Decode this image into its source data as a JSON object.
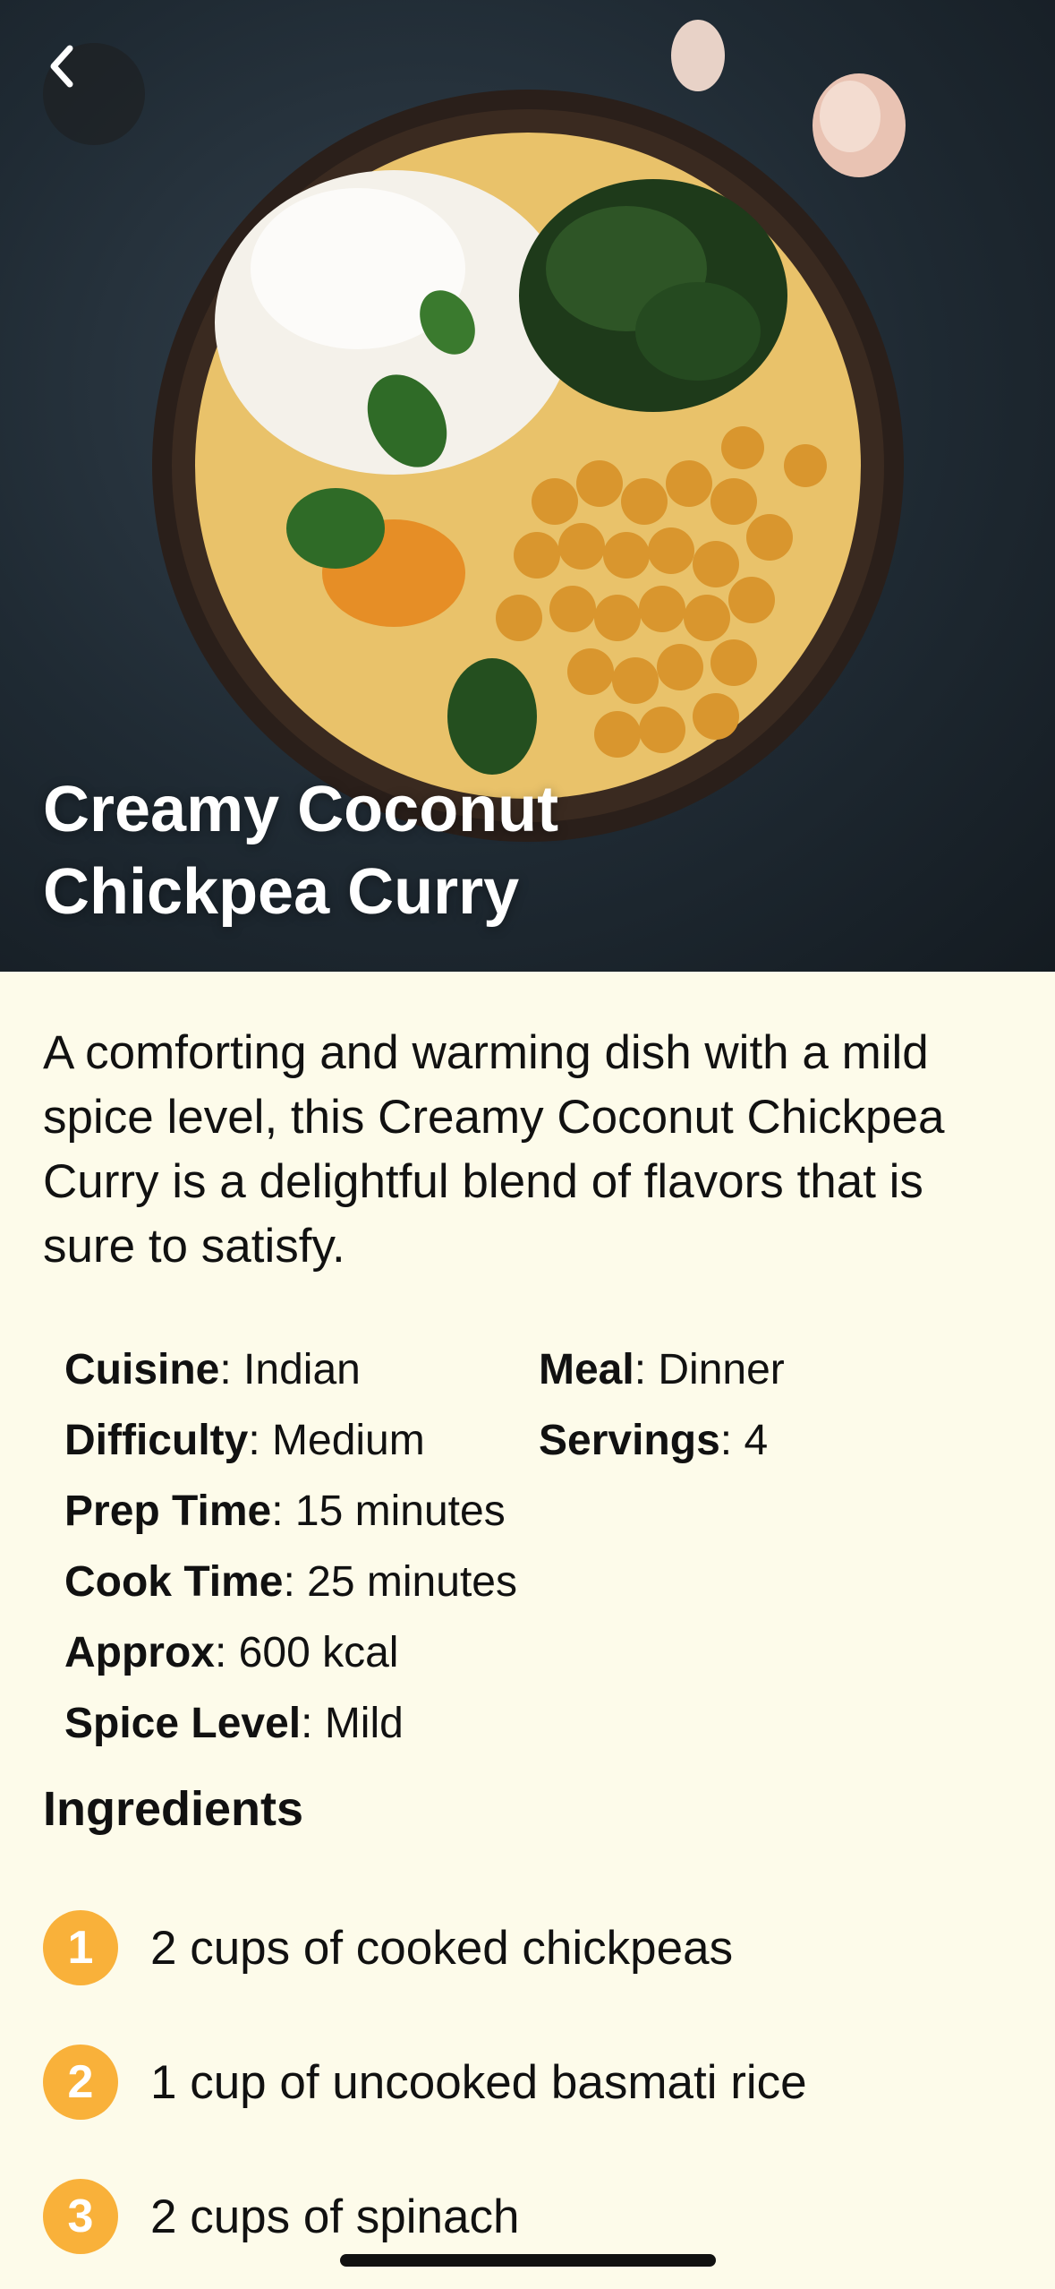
{
  "recipe": {
    "title_line1": "Creamy Coconut",
    "title_line2": "Chickpea Curry",
    "description": "A comforting and warming dish with a mild spice level, this Creamy Coconut Chickpea Curry is a delightful blend of flavors that is sure to satisfy."
  },
  "meta": {
    "cuisine_label": "Cuisine",
    "cuisine_value": "Indian",
    "meal_label": "Meal",
    "meal_value": "Dinner",
    "difficulty_label": "Difficulty",
    "difficulty_value": "Medium",
    "servings_label": "Servings",
    "servings_value": "4",
    "prep_label": "Prep Time",
    "prep_value": "15 minutes",
    "cook_label": "Cook Time",
    "cook_value": "25 minutes",
    "approx_label": "Approx",
    "approx_value": "600 kcal",
    "spice_label": "Spice Level",
    "spice_value": "Mild"
  },
  "ingredients_title": "Ingredients",
  "ingredients": [
    {
      "num": "1",
      "text": "2 cups of cooked chickpeas"
    },
    {
      "num": "2",
      "text": "1 cup of uncooked basmati rice"
    },
    {
      "num": "3",
      "text": "2 cups of spinach"
    }
  ],
  "icons": {
    "back": "chevron-left-icon"
  },
  "colors": {
    "background": "#FDFBEA",
    "accent": "#F9B13A",
    "text": "#111111"
  }
}
